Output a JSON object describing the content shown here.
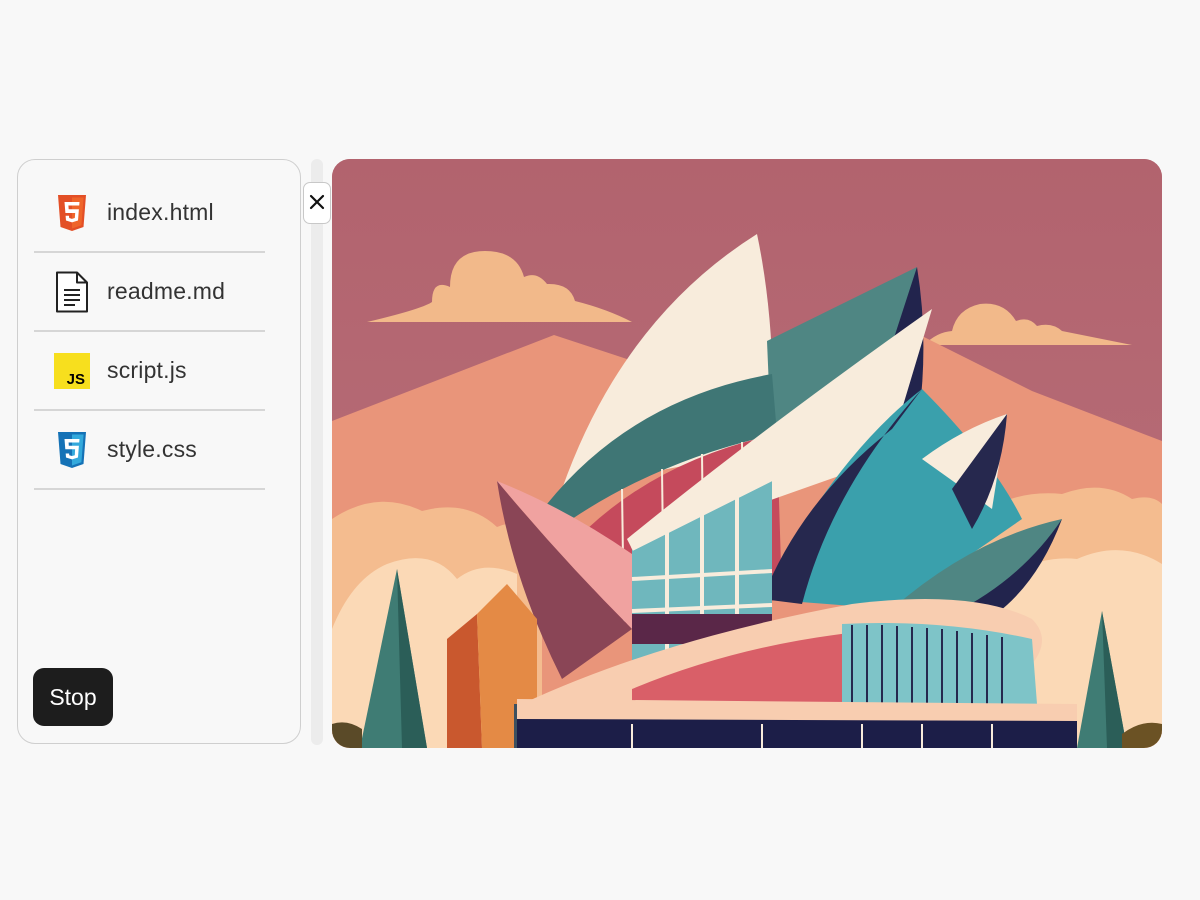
{
  "sidebar": {
    "files": [
      {
        "label": "index.html",
        "icon": "html5-icon"
      },
      {
        "label": "readme.md",
        "icon": "document-icon"
      },
      {
        "label": "script.js",
        "icon": "javascript-icon"
      },
      {
        "label": "style.css",
        "icon": "css3-icon"
      }
    ],
    "stop_label": "Stop"
  },
  "close_button": {
    "icon": "close-icon"
  },
  "preview": {
    "subject": "illustration-opera-house"
  },
  "colors": {
    "background": "#f8f8f8",
    "stop_button": "#1d1d1d",
    "html5": "#e34f26",
    "javascript": "#f7df1e",
    "css3": "#1572b6",
    "sky": "#b26670"
  }
}
